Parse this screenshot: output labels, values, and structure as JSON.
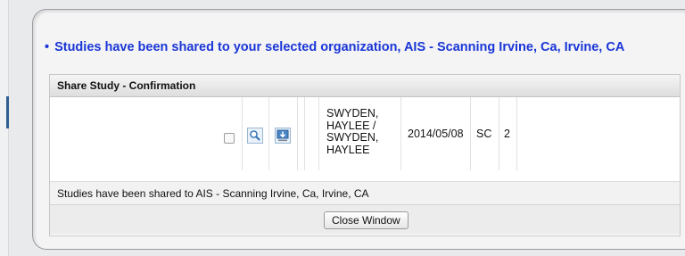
{
  "notice": {
    "bullet": "•",
    "text": "Studies have been shared to your selected organization, AIS - Scanning Irvine, Ca, Irvine, CA"
  },
  "confirmation": {
    "title": "Share Study - Confirmation",
    "study": {
      "patient_name": "SWYDEN, HAYLEE / SWYDEN, HAYLEE",
      "date": "2014/05/08",
      "modality": "SC",
      "count": "2"
    },
    "status": "Studies have been shared to AIS - Scanning Irvine, Ca, Irvine, CA",
    "close_label": "Close Window"
  },
  "icons": {
    "view": "magnifier-icon",
    "download": "download-icon"
  },
  "colors": {
    "notice_text": "#1a36d6",
    "header_bg": "#e2e2e2"
  }
}
